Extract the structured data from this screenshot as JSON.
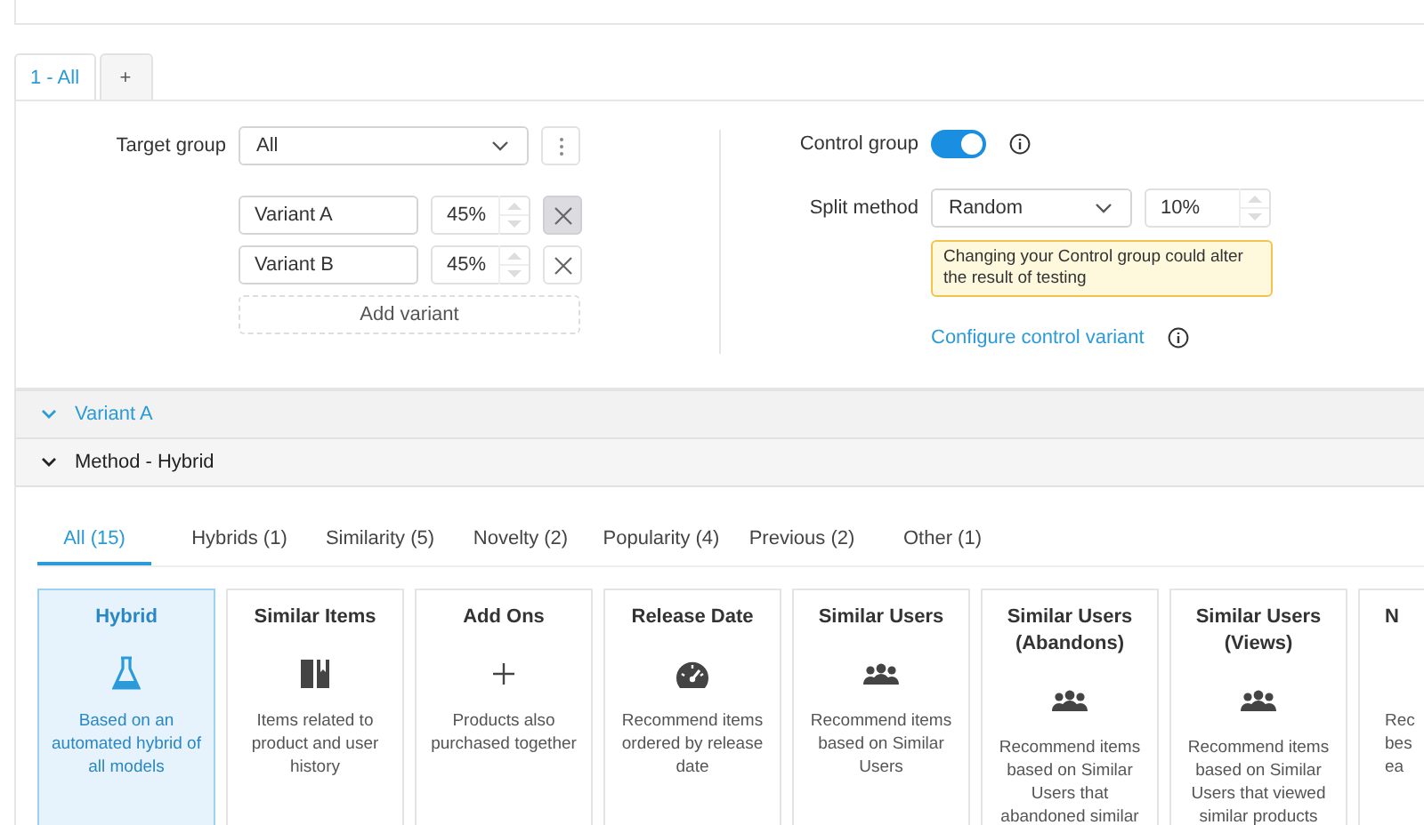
{
  "tabs": [
    {
      "label": "1 - All",
      "selected": true
    },
    {
      "label": "+",
      "selected": false
    }
  ],
  "target_group": {
    "label": "Target group",
    "value": "All"
  },
  "variants": [
    {
      "name": "Variant A",
      "share": "45%",
      "remove_hovered": true
    },
    {
      "name": "Variant B",
      "share": "45%",
      "remove_hovered": false
    }
  ],
  "add_variant": "Add variant",
  "control_group": {
    "label": "Control group",
    "on": true
  },
  "split_method": {
    "label": "Split method",
    "value": "Random",
    "share": "10%"
  },
  "warning": "Changing your Control group could alter the result of testing",
  "configure_link": "Configure control variant",
  "sections": [
    {
      "label": "Variant A",
      "active": true,
      "expanded": true
    },
    {
      "label": "Method - Hybrid",
      "active": false,
      "expanded": true
    }
  ],
  "method_tabs": [
    {
      "label": "All (15)",
      "selected": true
    },
    {
      "label": "Hybrids (1)",
      "selected": false
    },
    {
      "label": "Similarity (5)",
      "selected": false
    },
    {
      "label": "Novelty (2)",
      "selected": false
    },
    {
      "label": "Popularity (4)",
      "selected": false
    },
    {
      "label": "Previous (2)",
      "selected": false
    },
    {
      "label": "Other (1)",
      "selected": false
    }
  ],
  "cards": [
    {
      "title": "Hybrid",
      "kind": "flask",
      "description": "Based on an automated hybrid of all models",
      "selected": true
    },
    {
      "title": "Similar Items",
      "kind": "book",
      "description": "Items related to product and user history",
      "selected": false
    },
    {
      "title": "Add Ons",
      "kind": "plus",
      "description": "Products also purchased together",
      "selected": false
    },
    {
      "title": "Release Date",
      "kind": "gauge",
      "description": "Recommend items ordered by release date",
      "selected": false
    },
    {
      "title": "Similar Users",
      "kind": "users",
      "description": "Recommend items based on Similar Users",
      "selected": false
    },
    {
      "title": "Similar Users (Abandons)",
      "kind": "users",
      "description": "Recommend items based on Similar Users that abandoned similar",
      "selected": false
    },
    {
      "title": "Similar Users (Views)",
      "kind": "users",
      "description": "Recommend items based on Similar Users that viewed similar products",
      "selected": false
    },
    {
      "title": "N",
      "kind": "cut",
      "description": "Rec\nbes\nea",
      "selected": false
    }
  ]
}
